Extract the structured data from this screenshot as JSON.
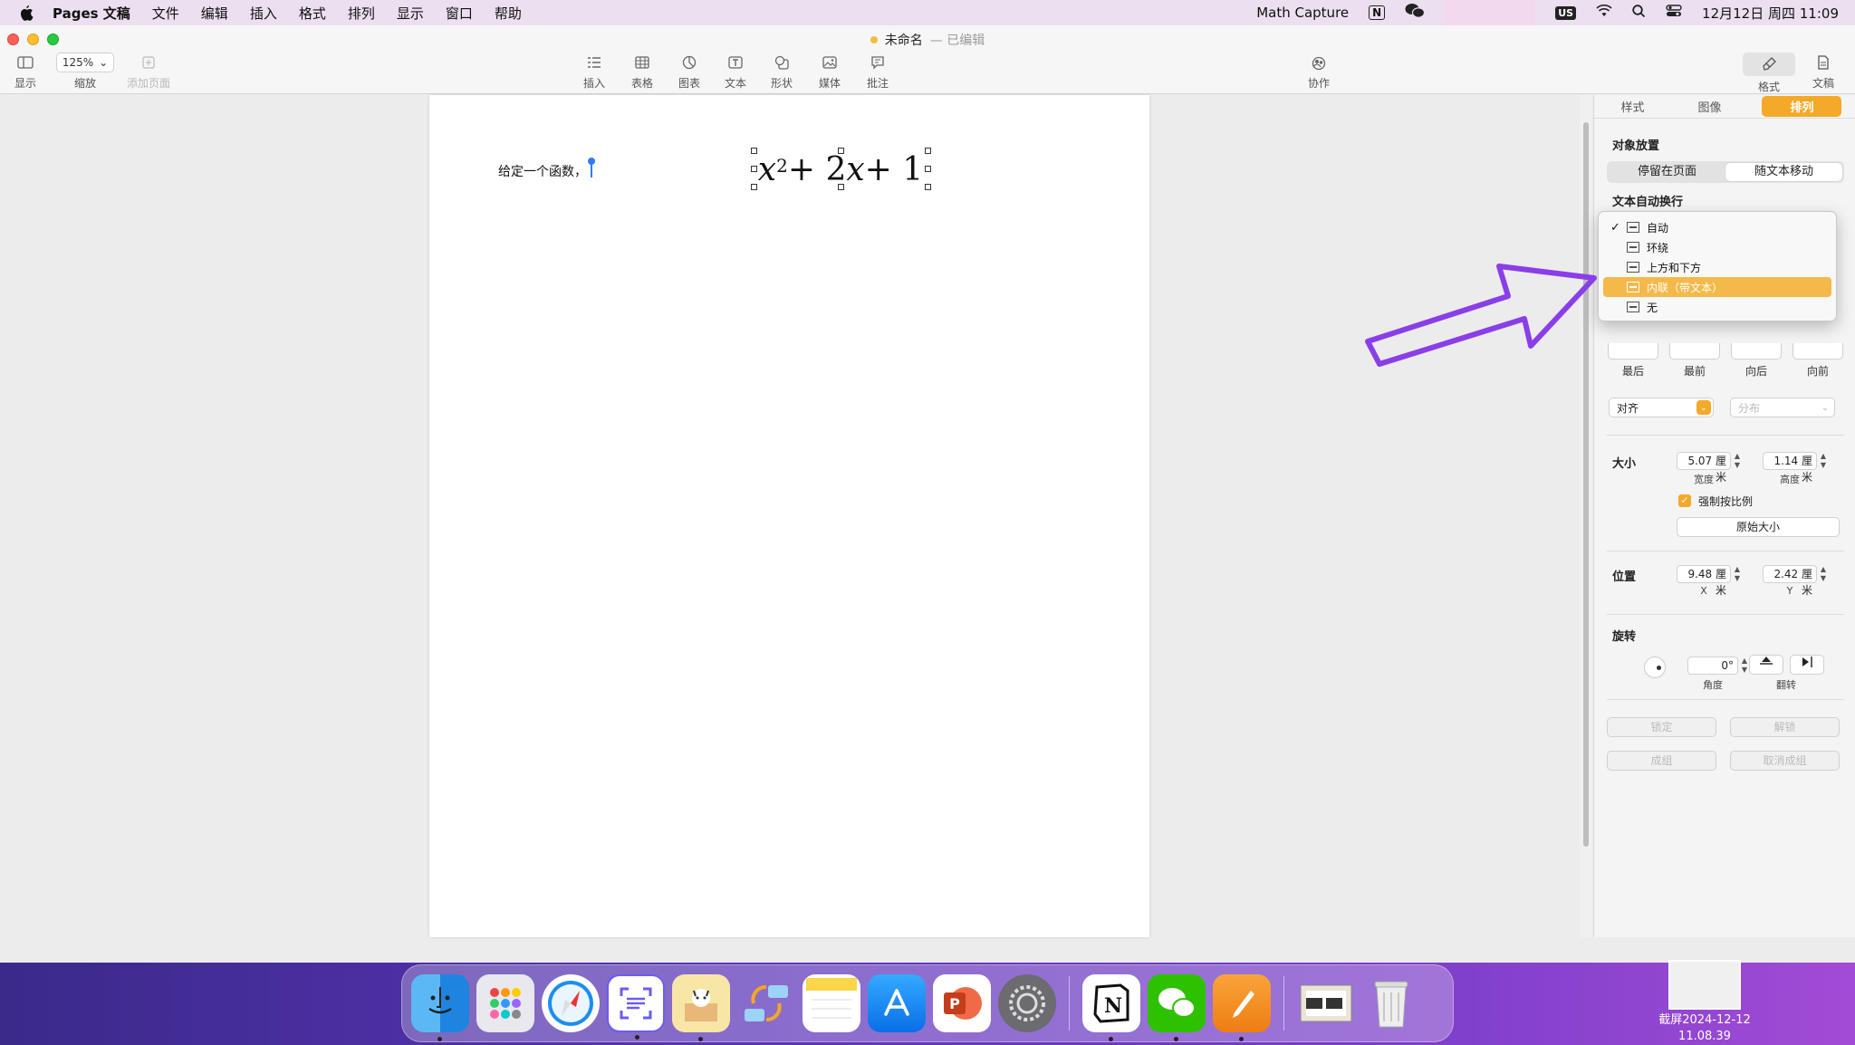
{
  "menubar": {
    "app_name": "Pages 文稿",
    "items": [
      "文件",
      "编辑",
      "插入",
      "格式",
      "排列",
      "显示",
      "窗口",
      "帮助"
    ],
    "math_capture": "Math Capture",
    "input_source": "US",
    "datetime": "12月12日 周四 11:09"
  },
  "window": {
    "title": "未命名",
    "edited": "已编辑"
  },
  "toolbar": {
    "view_label": "显示",
    "zoom_value": "125%",
    "zoom_label": "缩放",
    "add_page_label": "添加页面",
    "insert_label": "插入",
    "table_label": "表格",
    "chart_label": "图表",
    "text_label": "文本",
    "shape_label": "形状",
    "media_label": "媒体",
    "comment_label": "批注",
    "collaborate_label": "协作",
    "format_label": "格式",
    "document_label": "文稿"
  },
  "document": {
    "body_text": "给定一个函数，",
    "equation": {
      "base": "x",
      "exponent": "2",
      "rest_op1": " + 2",
      "rest_var": "x",
      "rest_op2": " + 1"
    }
  },
  "inspector": {
    "tabs": [
      "样式",
      "图像",
      "排列"
    ],
    "object_placement_title": "对象放置",
    "placement_options": [
      "停留在页面",
      "随文本移动"
    ],
    "text_wrap_title": "文本自动换行",
    "wrap_menu": [
      "自动",
      "环绕",
      "上方和下方",
      "内联（带文本）",
      "无"
    ],
    "arrange_buttons": [
      "最后",
      "最前",
      "向后",
      "向前"
    ],
    "align_label": "对齐",
    "distribute_label": "分布",
    "size_title": "大小",
    "width_value": "5.07 厘米",
    "width_label": "宽度",
    "height_value": "1.14 厘米",
    "height_label": "高度",
    "constrain_label": "强制按比例",
    "original_size_label": "原始大小",
    "position_title": "位置",
    "x_value": "9.48 厘米",
    "x_label": "X",
    "y_value": "2.42 厘米",
    "y_label": "Y",
    "rotate_title": "旋转",
    "angle_value": "0°",
    "angle_label": "角度",
    "flip_label": "翻转",
    "lock_label": "锁定",
    "unlock_label": "解锁",
    "group_label": "成组",
    "ungroup_label": "取消成组"
  },
  "desktop": {
    "screenshot_label_line1": "截屏2024-12-12",
    "screenshot_label_line2": "11.08.39"
  },
  "colors": {
    "accent": "#f4a928",
    "annotation_arrow": "#8a3ee8"
  }
}
